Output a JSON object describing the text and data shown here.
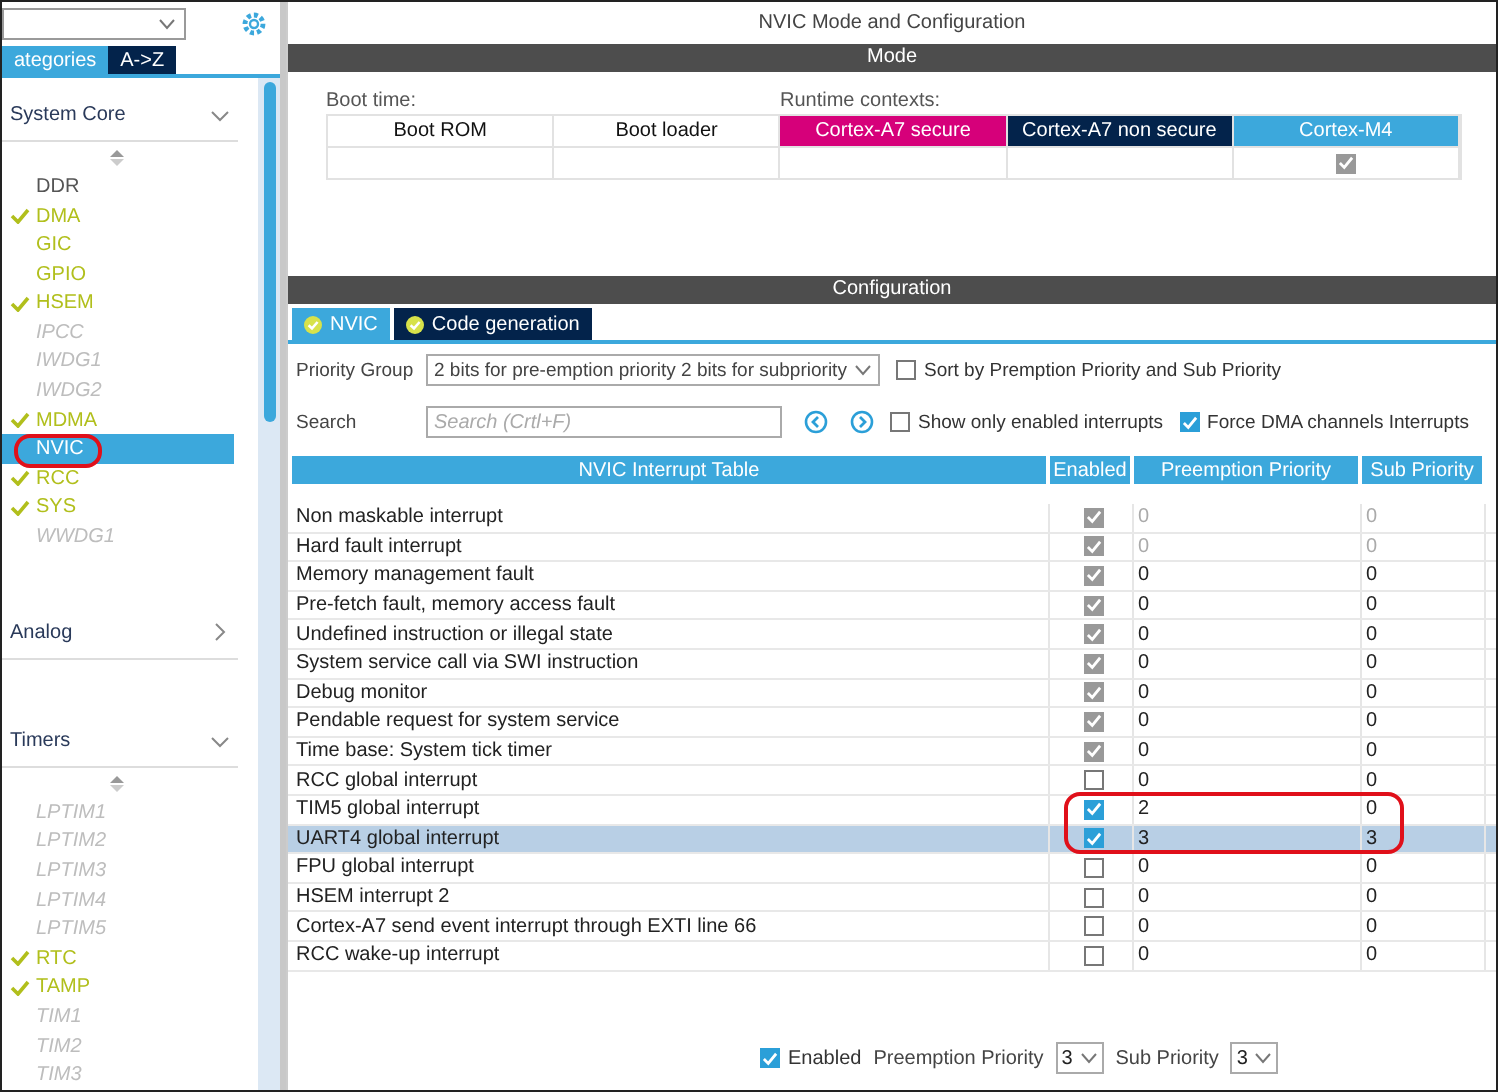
{
  "sidebar": {
    "tabs": [
      {
        "label": "ategories",
        "selected": true
      },
      {
        "label": "A->Z",
        "selected": false
      }
    ],
    "sections": [
      {
        "title": "System Core",
        "expanded": true,
        "items": [
          {
            "label": "DDR",
            "kind": "plain",
            "checked": false,
            "selected": false,
            "circled": false
          },
          {
            "label": "DMA",
            "kind": "active",
            "checked": true,
            "selected": false,
            "circled": false
          },
          {
            "label": "GIC",
            "kind": "active",
            "checked": false,
            "selected": false,
            "circled": false
          },
          {
            "label": "GPIO",
            "kind": "active",
            "checked": false,
            "selected": false,
            "circled": false
          },
          {
            "label": "HSEM",
            "kind": "active",
            "checked": true,
            "selected": false,
            "circled": false
          },
          {
            "label": "IPCC",
            "kind": "unavailable",
            "checked": false,
            "selected": false,
            "circled": false
          },
          {
            "label": "IWDG1",
            "kind": "unavailable",
            "checked": false,
            "selected": false,
            "circled": false
          },
          {
            "label": "IWDG2",
            "kind": "unavailable",
            "checked": false,
            "selected": false,
            "circled": false
          },
          {
            "label": "MDMA",
            "kind": "active",
            "checked": true,
            "selected": false,
            "circled": false
          },
          {
            "label": "NVIC",
            "kind": "active",
            "checked": false,
            "selected": true,
            "circled": true
          },
          {
            "label": "RCC",
            "kind": "active",
            "checked": true,
            "selected": false,
            "circled": false
          },
          {
            "label": "SYS",
            "kind": "active",
            "checked": true,
            "selected": false,
            "circled": false
          },
          {
            "label": "WWDG1",
            "kind": "unavailable",
            "checked": false,
            "selected": false,
            "circled": false
          }
        ]
      },
      {
        "title": "Analog",
        "expanded": false
      },
      {
        "title": "Timers",
        "expanded": true,
        "items": [
          {
            "label": "LPTIM1",
            "kind": "unavailable",
            "checked": false,
            "selected": false,
            "circled": false
          },
          {
            "label": "LPTIM2",
            "kind": "unavailable",
            "checked": false,
            "selected": false,
            "circled": false
          },
          {
            "label": "LPTIM3",
            "kind": "unavailable",
            "checked": false,
            "selected": false,
            "circled": false
          },
          {
            "label": "LPTIM4",
            "kind": "unavailable",
            "checked": false,
            "selected": false,
            "circled": false
          },
          {
            "label": "LPTIM5",
            "kind": "unavailable",
            "checked": false,
            "selected": false,
            "circled": false
          },
          {
            "label": "RTC",
            "kind": "active",
            "checked": true,
            "selected": false,
            "circled": false
          },
          {
            "label": "TAMP",
            "kind": "active",
            "checked": true,
            "selected": false,
            "circled": false
          },
          {
            "label": "TIM1",
            "kind": "unavailable",
            "checked": false,
            "selected": false,
            "circled": false
          },
          {
            "label": "TIM2",
            "kind": "unavailable",
            "checked": false,
            "selected": false,
            "circled": false
          },
          {
            "label": "TIM3",
            "kind": "unavailable",
            "checked": false,
            "selected": false,
            "circled": false
          }
        ]
      }
    ]
  },
  "main": {
    "title": "NVIC Mode and Configuration"
  },
  "mode": {
    "heading": "Mode",
    "boot_label": "Boot time:",
    "runtime_label": "Runtime contexts:",
    "contexts": [
      {
        "label": "Boot ROM",
        "kind": "boot",
        "checked": false
      },
      {
        "label": "Boot loader",
        "kind": "boot",
        "checked": false
      },
      {
        "label": "Cortex-A7 secure",
        "kind": "runtime",
        "color": "#d6007a",
        "checked": false
      },
      {
        "label": "Cortex-A7 non secure",
        "kind": "runtime",
        "color": "#03234b",
        "checked": false
      },
      {
        "label": "Cortex-M4",
        "kind": "runtime",
        "color": "#3ca8dc",
        "checked": true
      }
    ]
  },
  "configuration": {
    "heading": "Configuration",
    "tabs": [
      {
        "label": "NVIC",
        "selected": true
      },
      {
        "label": "Code generation",
        "selected": false
      }
    ],
    "priority_group": {
      "label": "Priority Group",
      "value": "2 bits for pre-emption priority 2 bits for subpriority"
    },
    "search": {
      "label": "Search",
      "placeholder": "Search (Crtl+F)"
    },
    "options": [
      {
        "label": "Sort by Premption Priority and Sub Priority",
        "checked": false
      },
      {
        "label": "Show only enabled interrupts",
        "checked": false
      },
      {
        "label": "Force DMA channels Interrupts",
        "checked": true
      }
    ],
    "table": {
      "columns": [
        "NVIC Interrupt Table",
        "Enabled",
        "Preemption Priority",
        "Sub Priority"
      ],
      "rows": [
        {
          "name": "Non maskable interrupt",
          "enabled": true,
          "locked": true,
          "priority_locked": true,
          "preemption": "0",
          "sub": "0",
          "selected": false,
          "circled": false
        },
        {
          "name": "Hard fault interrupt",
          "enabled": true,
          "locked": true,
          "priority_locked": true,
          "preemption": "0",
          "sub": "0",
          "selected": false,
          "circled": false
        },
        {
          "name": "Memory management fault",
          "enabled": true,
          "locked": true,
          "priority_locked": false,
          "preemption": "0",
          "sub": "0",
          "selected": false,
          "circled": false
        },
        {
          "name": "Pre-fetch fault, memory access fault",
          "enabled": true,
          "locked": true,
          "priority_locked": false,
          "preemption": "0",
          "sub": "0",
          "selected": false,
          "circled": false
        },
        {
          "name": "Undefined instruction or illegal state",
          "enabled": true,
          "locked": true,
          "priority_locked": false,
          "preemption": "0",
          "sub": "0",
          "selected": false,
          "circled": false
        },
        {
          "name": "System service call via SWI instruction",
          "enabled": true,
          "locked": true,
          "priority_locked": false,
          "preemption": "0",
          "sub": "0",
          "selected": false,
          "circled": false
        },
        {
          "name": "Debug monitor",
          "enabled": true,
          "locked": true,
          "priority_locked": false,
          "preemption": "0",
          "sub": "0",
          "selected": false,
          "circled": false
        },
        {
          "name": "Pendable request for system service",
          "enabled": true,
          "locked": true,
          "priority_locked": false,
          "preemption": "0",
          "sub": "0",
          "selected": false,
          "circled": false
        },
        {
          "name": "Time base: System tick timer",
          "enabled": true,
          "locked": true,
          "priority_locked": false,
          "preemption": "0",
          "sub": "0",
          "selected": false,
          "circled": false
        },
        {
          "name": "RCC global interrupt",
          "enabled": false,
          "locked": false,
          "priority_locked": false,
          "preemption": "0",
          "sub": "0",
          "selected": false,
          "circled": false
        },
        {
          "name": "TIM5 global interrupt",
          "enabled": true,
          "locked": false,
          "priority_locked": false,
          "preemption": "2",
          "sub": "0",
          "selected": false,
          "circled": true
        },
        {
          "name": "UART4 global interrupt",
          "enabled": true,
          "locked": false,
          "priority_locked": false,
          "preemption": "3",
          "sub": "3",
          "selected": true,
          "circled": true
        },
        {
          "name": "FPU global interrupt",
          "enabled": false,
          "locked": false,
          "priority_locked": false,
          "preemption": "0",
          "sub": "0",
          "selected": false,
          "circled": false
        },
        {
          "name": "HSEM interrupt 2",
          "enabled": false,
          "locked": false,
          "priority_locked": false,
          "preemption": "0",
          "sub": "0",
          "selected": false,
          "circled": false
        },
        {
          "name": "Cortex-A7 send event interrupt through EXTI line 66",
          "enabled": false,
          "locked": false,
          "priority_locked": false,
          "preemption": "0",
          "sub": "0",
          "selected": false,
          "circled": false
        },
        {
          "name": "RCC wake-up interrupt",
          "enabled": false,
          "locked": false,
          "priority_locked": false,
          "preemption": "0",
          "sub": "0",
          "selected": false,
          "circled": false
        }
      ]
    },
    "footer": {
      "enabled": {
        "label": "Enabled",
        "checked": true
      },
      "preemption": {
        "label": "Preemption Priority",
        "value": "3"
      },
      "sub": {
        "label": "Sub Priority",
        "value": "3"
      }
    }
  }
}
